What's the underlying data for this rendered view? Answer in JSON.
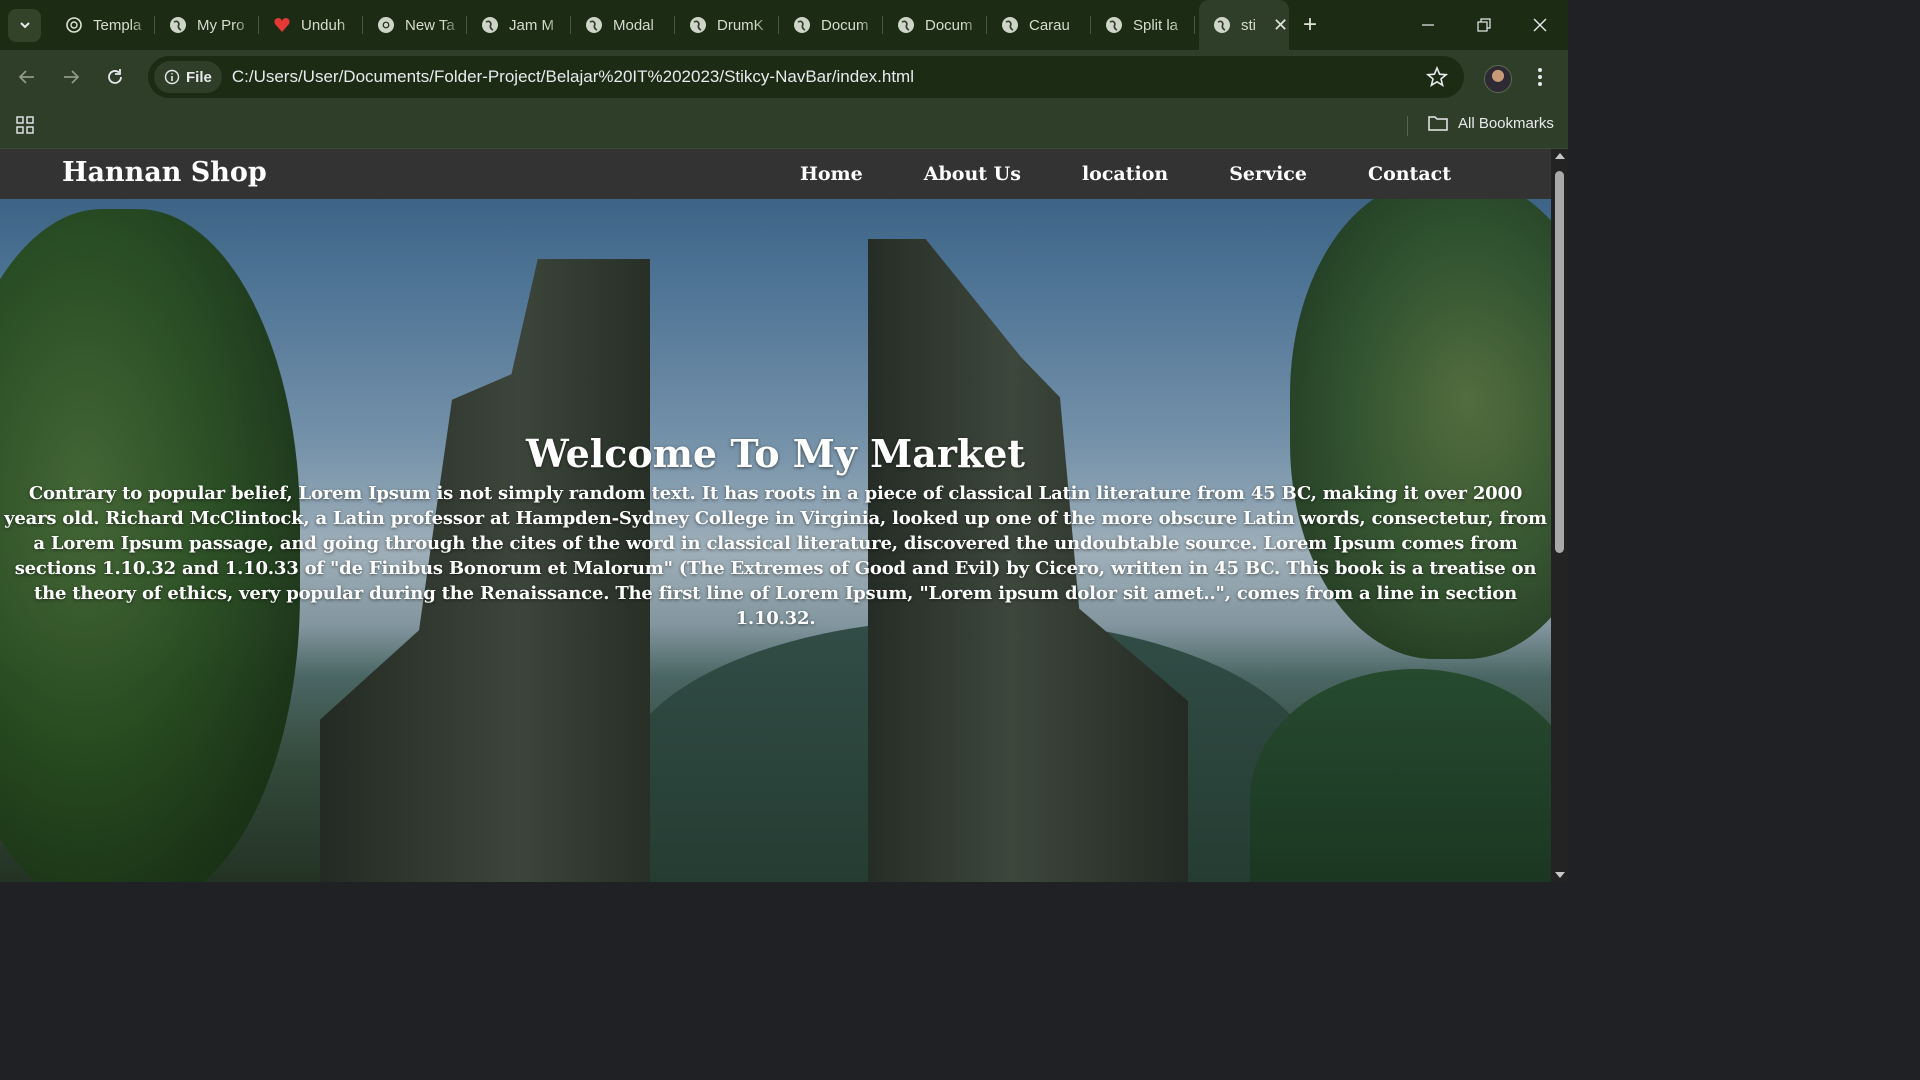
{
  "browser": {
    "tabs": [
      {
        "title": "Templa",
        "icon": "openai-icon"
      },
      {
        "title": "My Pro",
        "icon": "globe-icon"
      },
      {
        "title": "Unduh",
        "icon": "heart-icon"
      },
      {
        "title": "New Ta",
        "icon": "chrome-icon"
      },
      {
        "title": "Jam M",
        "icon": "globe-icon"
      },
      {
        "title": "Modal",
        "icon": "globe-icon"
      },
      {
        "title": "DrumK",
        "icon": "globe-icon"
      },
      {
        "title": "Docum",
        "icon": "globe-icon"
      },
      {
        "title": "Docum",
        "icon": "globe-icon"
      },
      {
        "title": "Carau",
        "icon": "globe-icon"
      },
      {
        "title": "Split la",
        "icon": "globe-icon"
      }
    ],
    "active_tab": {
      "title": "sti",
      "icon": "globe-icon"
    },
    "address": {
      "chip_label": "File",
      "url": "C:/Users/User/Documents/Folder-Project/Belajar%20IT%202023/Stikcy-NavBar/index.html"
    },
    "bookmarks": {
      "all_label": "All Bookmarks"
    },
    "colors": {
      "frame": "#1b2b14",
      "toolbar": "#2e3e28"
    }
  },
  "site": {
    "brand": "Hannan Shop",
    "nav": [
      "Home",
      "About Us",
      "location",
      "Service",
      "Contact"
    ],
    "hero": {
      "title": "Welcome To My Market",
      "body": "Contrary to popular belief, Lorem Ipsum is not simply random text. It has roots in a piece of classical Latin literature from 45 BC, making it over 2000 years old. Richard McClintock, a Latin professor at Hampden-Sydney College in Virginia, looked up one of the more obscure Latin words, consectetur, from a Lorem Ipsum passage, and going through the cites of the word in classical literature, discovered the undoubtable source. Lorem Ipsum comes from sections 1.10.32 and 1.10.33 of \"de Finibus Bonorum et Malorum\" (The Extremes of Good and Evil) by Cicero, written in 45 BC. This book is a treatise on the theory of ethics, very popular during the Renaissance. The first line of Lorem Ipsum, \"Lorem ipsum dolor sit amet..\", comes from a line in section 1.10.32."
    },
    "colors": {
      "navbar": "#333333",
      "text": "#ffffff"
    }
  }
}
